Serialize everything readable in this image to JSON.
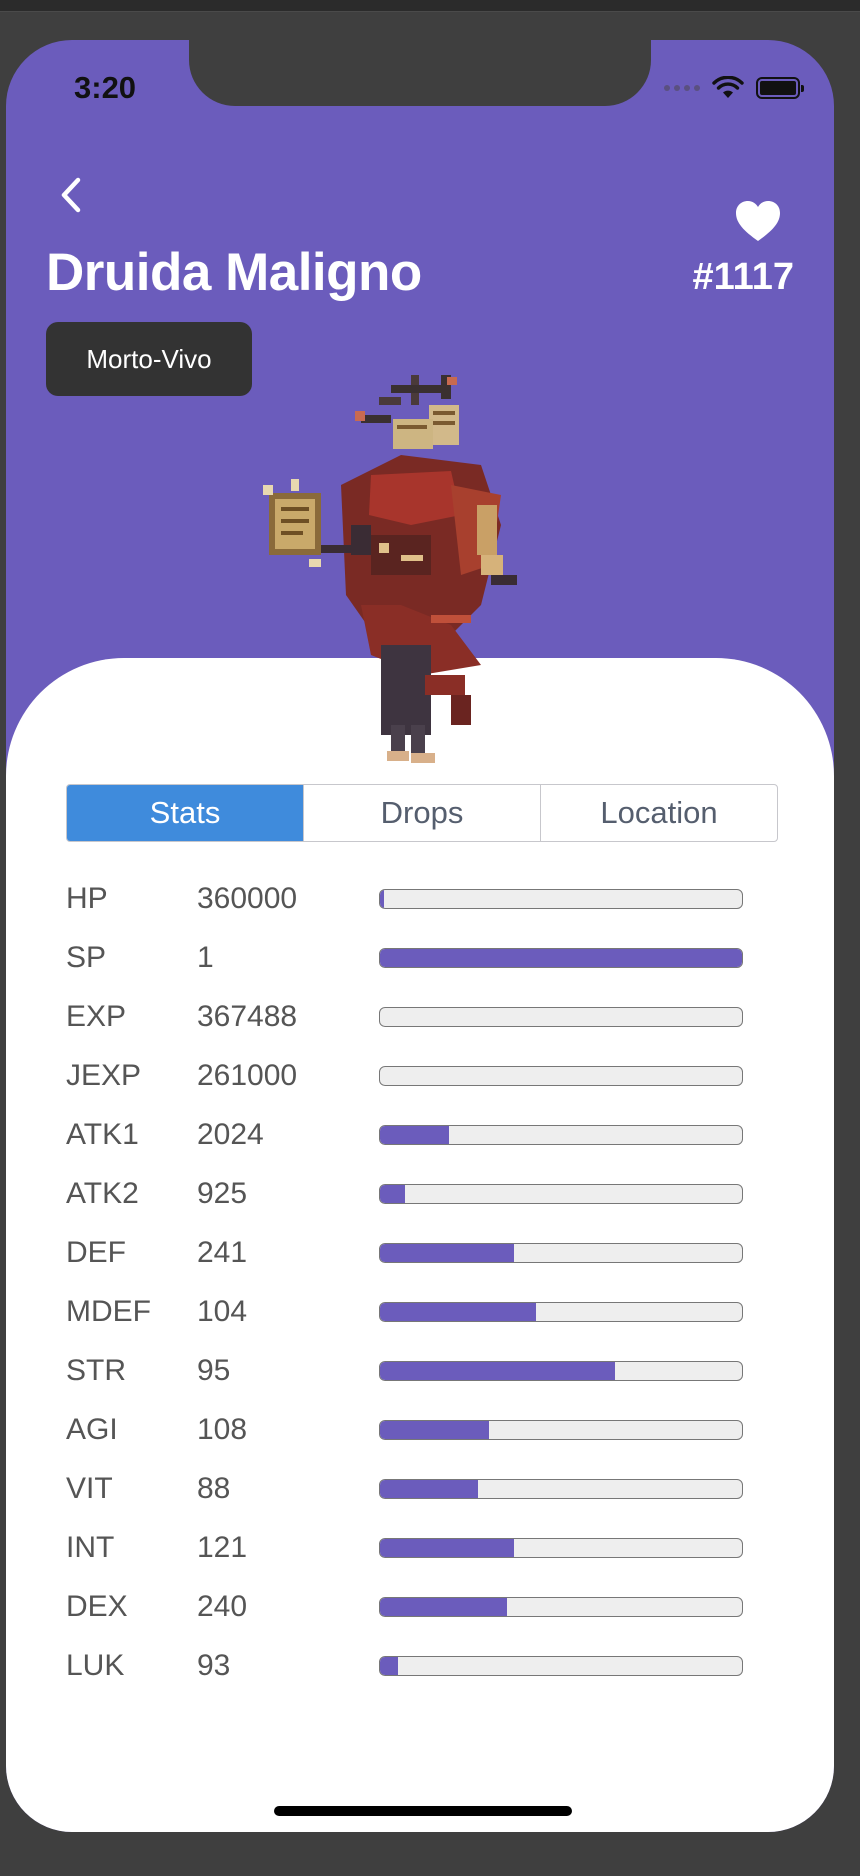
{
  "status_bar": {
    "time": "3:20"
  },
  "header": {
    "title": "Druida Maligno",
    "number": "#1117",
    "race": "Morto-Vivo"
  },
  "colors": {
    "accent": "#6b5cbc",
    "tab_active": "#3f8bdc"
  },
  "tabs": [
    {
      "label": "Stats",
      "active": true
    },
    {
      "label": "Drops",
      "active": false
    },
    {
      "label": "Location",
      "active": false
    }
  ],
  "stats": [
    {
      "label": "HP",
      "value": "360000",
      "fill": 0.01
    },
    {
      "label": "SP",
      "value": "1",
      "fill": 1.0
    },
    {
      "label": "EXP",
      "value": "367488",
      "fill": 0.0
    },
    {
      "label": "JEXP",
      "value": "261000",
      "fill": 0.0
    },
    {
      "label": "ATK1",
      "value": "2024",
      "fill": 0.19
    },
    {
      "label": "ATK2",
      "value": "925",
      "fill": 0.07
    },
    {
      "label": "DEF",
      "value": "241",
      "fill": 0.37
    },
    {
      "label": "MDEF",
      "value": "104",
      "fill": 0.43
    },
    {
      "label": "STR",
      "value": "95",
      "fill": 0.65
    },
    {
      "label": "AGI",
      "value": "108",
      "fill": 0.3
    },
    {
      "label": "VIT",
      "value": "88",
      "fill": 0.27
    },
    {
      "label": "INT",
      "value": "121",
      "fill": 0.37
    },
    {
      "label": "DEX",
      "value": "240",
      "fill": 0.35
    },
    {
      "label": "LUK",
      "value": "93",
      "fill": 0.05
    }
  ],
  "icons": [
    "back-chevron-icon",
    "heart-icon",
    "signal-icon",
    "wifi-icon",
    "battery-icon"
  ]
}
